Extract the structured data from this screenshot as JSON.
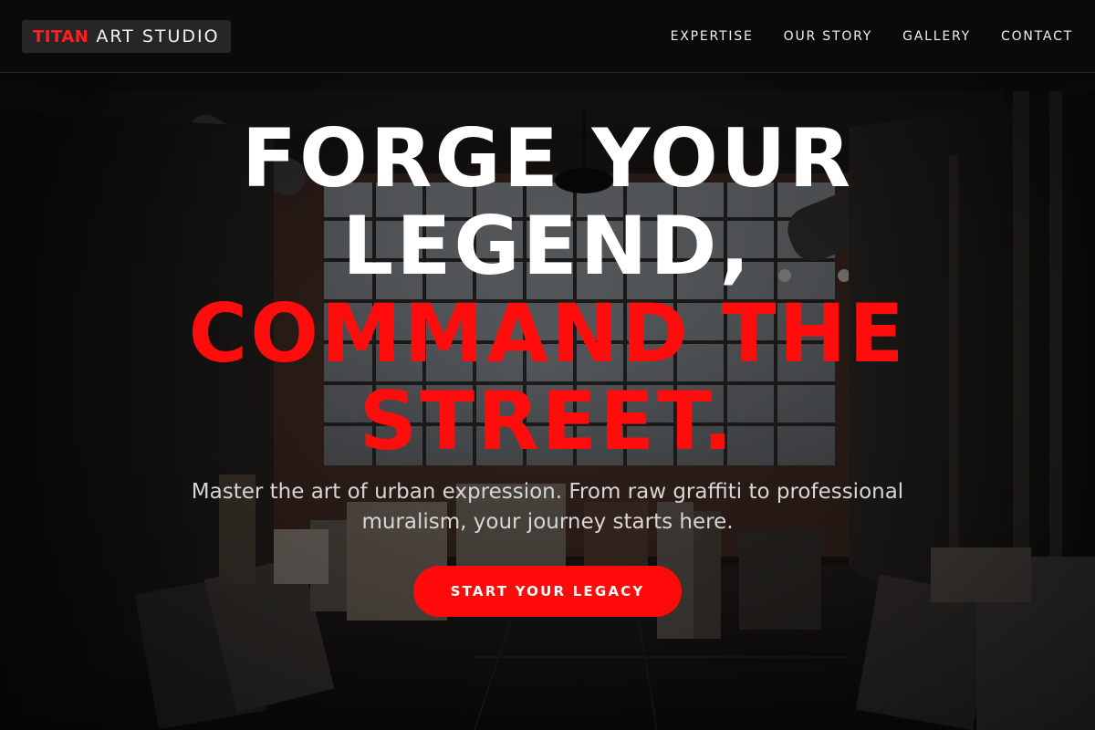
{
  "header": {
    "logo": {
      "brand": "TITAN",
      "rest": "ART STUDIO"
    },
    "nav": [
      {
        "label": "EXPERTISE"
      },
      {
        "label": "OUR STORY"
      },
      {
        "label": "GALLERY"
      },
      {
        "label": "CONTACT"
      }
    ]
  },
  "hero": {
    "headline_white_1": "FORGE YOUR",
    "headline_white_2": "LEGEND,",
    "headline_red_1": "COMMAND THE",
    "headline_red_2": "STREET.",
    "subtitle": "Master the art of urban expression. From raw graffiti to professional muralism, your journey starts here.",
    "cta_label": "START YOUR LEGACY",
    "background": "dim industrial art studio warehouse with large windows, stacked canvases and hanging lamps"
  },
  "colors": {
    "accent": "#ff0d0d",
    "header_bg": "#0a0a0a",
    "text": "#ffffff",
    "subtitle": "#d6d6d6"
  }
}
